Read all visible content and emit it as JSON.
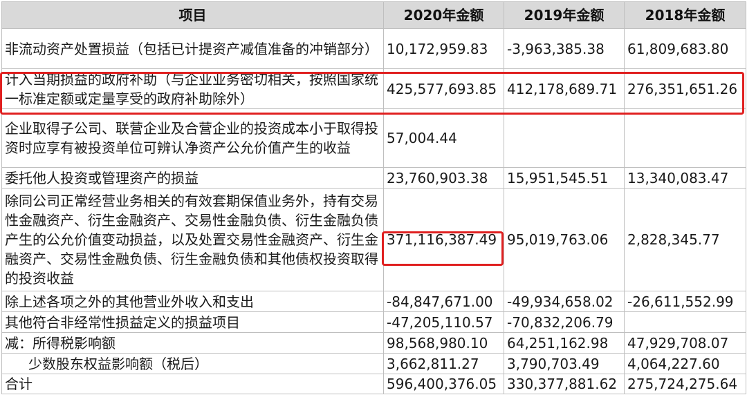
{
  "headers": [
    "项目",
    "2020年金额",
    "2019年金额",
    "2018年金额"
  ],
  "rows": [
    {
      "item": "非流动资产处置损益（包括已计提资产减值准备的冲销部分）",
      "v2020": "10,172,959.83",
      "v2019": "-3,963,385.38",
      "v2018": "61,809,683.80"
    },
    {
      "item": "计入当期损益的政府补助（与企业业务密切相关，按照国家统 一标准定额或定量享受的政府补助除外）",
      "v2020": "425,577,693.85",
      "v2019": "412,178,689.71",
      "v2018": "276,351,651.26"
    },
    {
      "item": "企业取得子公司、联营企业及合营企业的投资成本小于取得投 资时应享有被投资单位可辨认净资产公允价值产生的收益",
      "v2020": "57,004.44",
      "v2019": "",
      "v2018": ""
    },
    {
      "item": "委托他人投资或管理资产的损益",
      "v2020": "23,760,903.38",
      "v2019": "15,951,545.51",
      "v2018": "13,340,083.47"
    },
    {
      "item": "除同公司正常经营业务相关的有效套期保值业务外，持有交易 性金融资产、衍生金融资产、交易性金融负债、衍生金融负债 产生的公允价值变动损益，以及处置交易性金融资产、衍生金 融资产、交易性金融负债、衍生金融负债和其他债权投资取得 的投资收益",
      "v2020": "371,116,387.49",
      "v2019": "95,019,763.06",
      "v2018": "2,828,345.77"
    },
    {
      "item": "除上述各项之外的其他营业外收入和支出",
      "v2020": "-84,847,671.00",
      "v2019": "-49,934,658.02",
      "v2018": "-26,611,552.99"
    },
    {
      "item": "其他符合非经常性损益定义的损益项目",
      "v2020": "-47,205,110.57",
      "v2019": "-70,832,206.79",
      "v2018": ""
    },
    {
      "item": "减：所得税影响额",
      "v2020": "98,568,980.10",
      "v2019": "64,251,162.98",
      "v2018": "47,929,708.07"
    },
    {
      "item": "少数股东权益影响额（税后）",
      "v2020": "3,662,811.27",
      "v2019": "3,790,703.49",
      "v2018": "4,064,227.60"
    },
    {
      "item": "合计",
      "v2020": "596,400,376.05",
      "v2019": "330,377,881.62",
      "v2018": "275,724,275.64"
    }
  ],
  "highlight_color": "#e02020",
  "header_bg": "#d9d9d9"
}
